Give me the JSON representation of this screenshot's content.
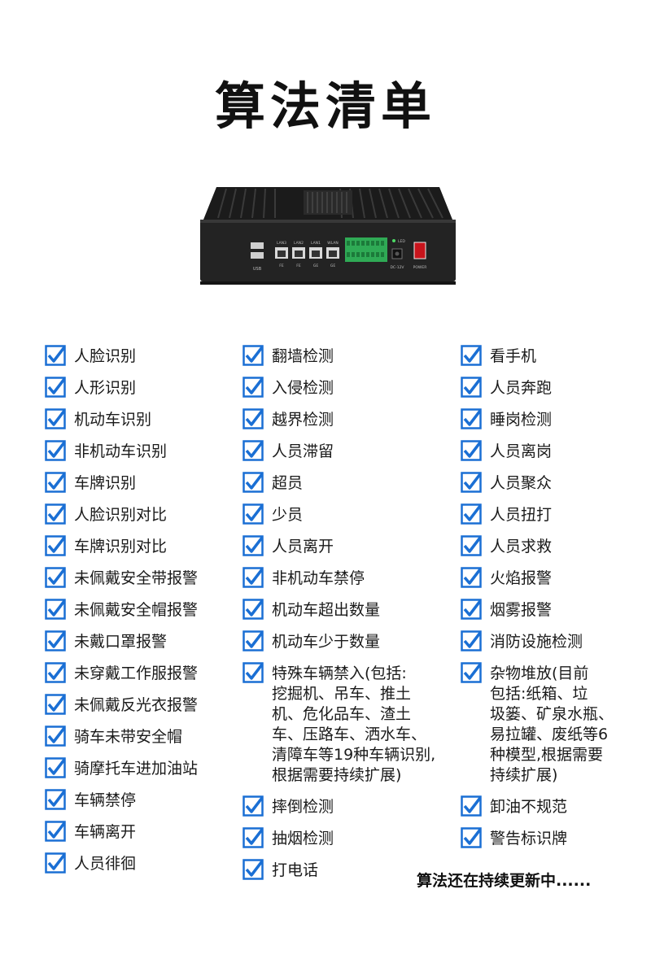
{
  "title": "算法清单",
  "device": {
    "ports": [
      "LAN3",
      "LAN2",
      "LAN1",
      "WLAN"
    ],
    "port_sublabels": [
      "FE",
      "FE",
      "GE",
      "GE"
    ],
    "usb_label": "USB",
    "led_label": "LED",
    "dc_label": "DC-12V",
    "power_label": "POWER"
  },
  "columns": [
    {
      "items": [
        "人脸识别",
        "人形识别",
        "机动车识别",
        "非机动车识别",
        "车牌识别",
        "人脸识别对比",
        "车牌识别对比",
        "未佩戴安全带报警",
        "未佩戴安全帽报警",
        "未戴口罩报警",
        "未穿戴工作服报警",
        "未佩戴反光衣报警",
        "骑车未带安全帽",
        "骑摩托车进加油站",
        "车辆禁停",
        "车辆离开",
        "人员徘徊"
      ]
    },
    {
      "items": [
        "翻墙检测",
        "入侵检测",
        "越界检测",
        "人员滞留",
        "超员",
        "少员",
        "人员离开",
        "非机动车禁停",
        "机动车超出数量",
        "机动车少于数量",
        "特殊车辆禁入(包括:\n挖掘机、吊车、推土\n机、危化品车、渣土\n车、压路车、洒水车、\n清障车等19种车辆识别,\n根据需要持续扩展)",
        "摔倒检测",
        "抽烟检测",
        "打电话"
      ]
    },
    {
      "items": [
        "看手机",
        "人员奔跑",
        "睡岗检测",
        "人员离岗",
        "人员聚众",
        "人员扭打",
        "人员求救",
        "火焰报警",
        "烟雾报警",
        "消防设施检测",
        "杂物堆放(目前\n包括:纸箱、垃\n圾篓、矿泉水瓶、\n易拉罐、废纸等6\n种模型,根据需要\n持续扩展)",
        "卸油不规范",
        "警告标识牌"
      ]
    }
  ],
  "footer_note": "算法还在持续更新中......",
  "colors": {
    "check": "#1a6fd4",
    "text": "#1a1a1a"
  }
}
